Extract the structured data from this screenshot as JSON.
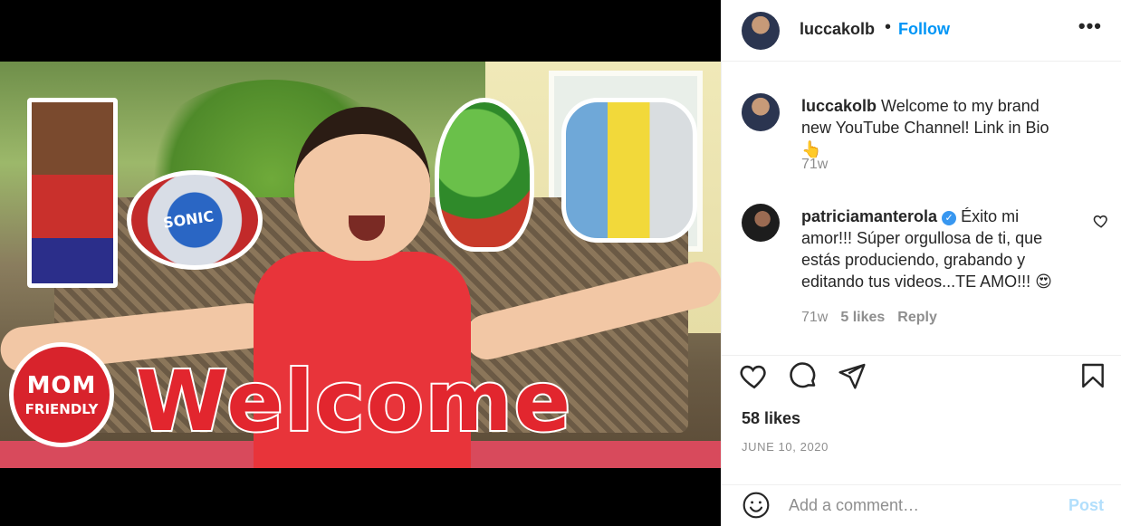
{
  "post": {
    "author": "luccakolb",
    "separator": "•",
    "follow_label": "Follow",
    "more_icon": "•••",
    "image_text": {
      "badge_line1": "MOM",
      "badge_line2": "FRIENDLY",
      "headline": "Welcome",
      "sonic_label": "SONIC"
    }
  },
  "caption": {
    "username": "luccakolb",
    "text": "Welcome to my brand new YouTube Channel! Link in Bio 👆",
    "time": "71w"
  },
  "comments": [
    {
      "username": "patriciamanterola",
      "verified_icon": "✓",
      "text": "Éxito mi amor!!! Súper orgullosa de ti, que estás produciendo, grabando y editando tus videos...TE AMO!!! 😍",
      "time": "71w",
      "likes": "5 likes",
      "reply": "Reply"
    }
  ],
  "actions": {
    "likes": "58 likes",
    "date": "JUNE 10, 2020"
  },
  "add_comment": {
    "placeholder": "Add a comment…",
    "post_label": "Post"
  },
  "colors": {
    "link_blue": "#0095f6",
    "muted": "#8e8e8e",
    "post_disabled": "#b2dffc"
  }
}
